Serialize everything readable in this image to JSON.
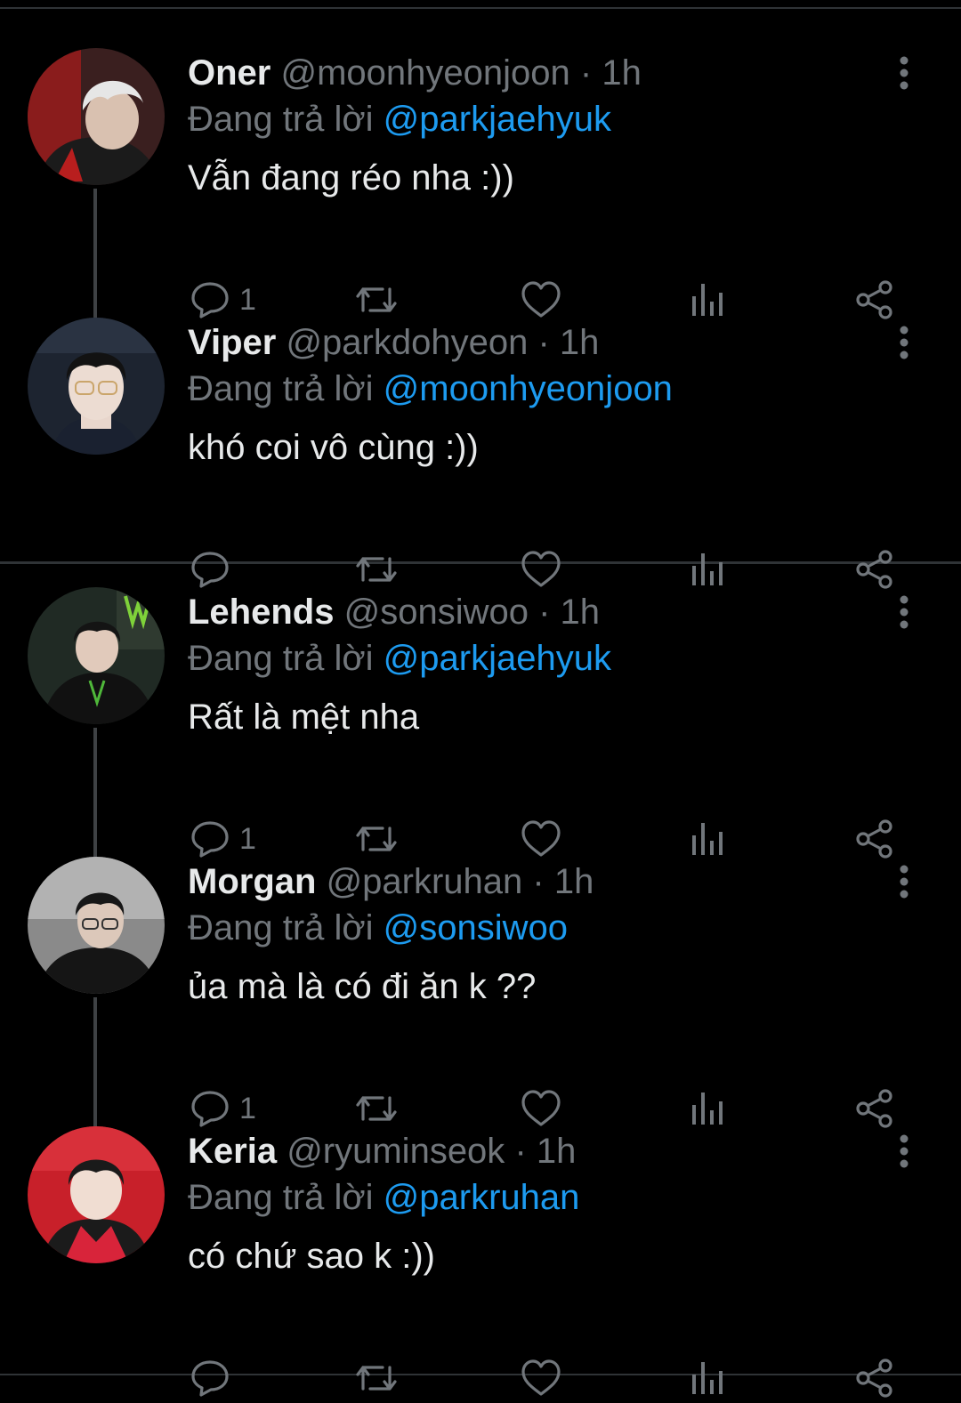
{
  "replying_prefix": "Đang trả lời",
  "tweets": [
    {
      "name": "Oner",
      "handle": "@moonhyeonjoon",
      "time": "1h",
      "reply_to": "@parkjaehyuk",
      "text": "Vẫn đang réo nha :))",
      "reply_count": "1",
      "avatar_icon": "oner-avatar"
    },
    {
      "name": "Viper",
      "handle": "@parkdohyeon",
      "time": "1h",
      "reply_to": "@moonhyeonjoon",
      "text": "khó coi vô cùng :))",
      "reply_count": "",
      "avatar_icon": "viper-avatar"
    },
    {
      "name": "Lehends",
      "handle": "@sonsiwoo",
      "time": "1h",
      "reply_to": "@parkjaehyuk",
      "text": "Rất là mệt nha",
      "reply_count": "1",
      "avatar_icon": "lehends-avatar"
    },
    {
      "name": "Morgan",
      "handle": "@parkruhan",
      "time": "1h",
      "reply_to": "@sonsiwoo",
      "text": "ủa mà là có đi ăn k ??",
      "reply_count": "1",
      "avatar_icon": "morgan-avatar"
    },
    {
      "name": "Keria",
      "handle": "@ryuminseok",
      "time": "1h",
      "reply_to": "@parkruhan",
      "text": "có chứ sao k :))",
      "reply_count": "",
      "avatar_icon": "keria-avatar"
    }
  ],
  "colors": {
    "background": "#000000",
    "text": "#e7e9ea",
    "secondary": "#71767b",
    "link": "#1d9bf0",
    "divider": "#2f3336"
  }
}
